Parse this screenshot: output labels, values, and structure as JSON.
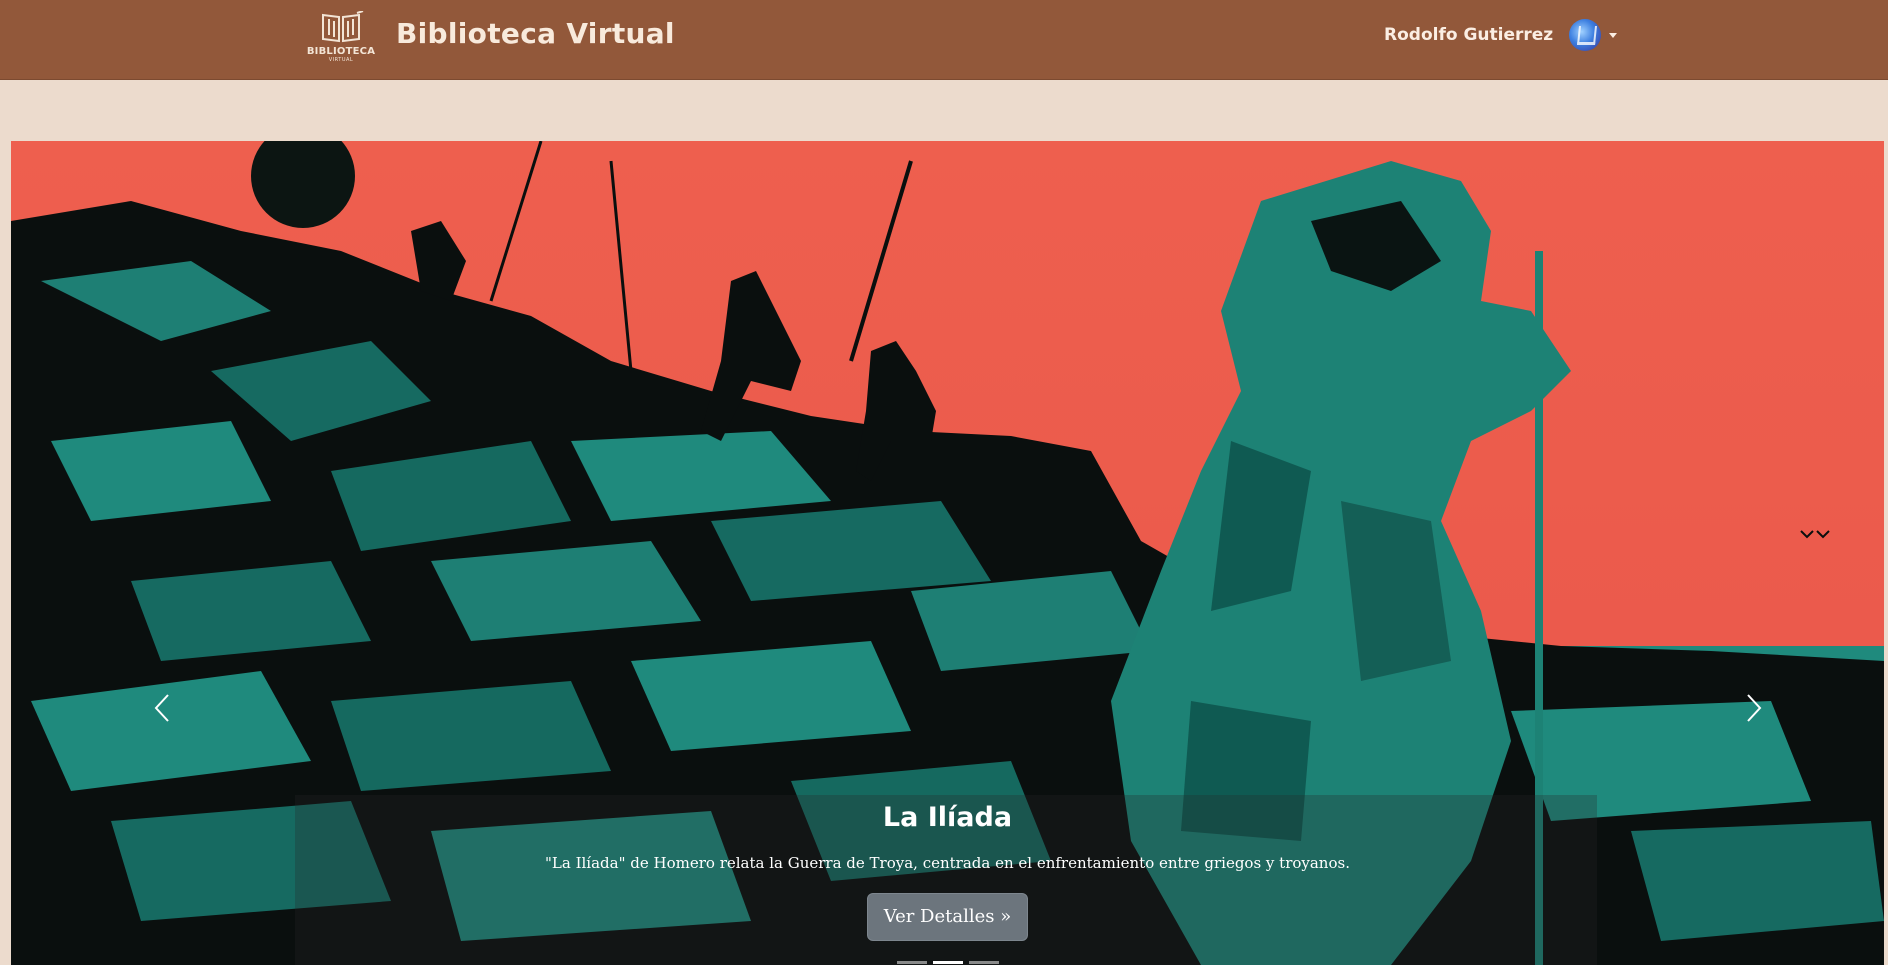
{
  "header": {
    "logo_text": "BIBLIOTECA",
    "logo_subtext": "VIRTUAL",
    "title": "Biblioteca Virtual",
    "user_name": "Rodolfo Gutierrez"
  },
  "carousel": {
    "slide": {
      "title": "La Ilíada",
      "description": "\"La Ilíada\" de Homero relata la Guerra de Troya, centrada en el enfrentamiento entre griegos y troyanos.",
      "button_label": "Ver Detalles »"
    },
    "indicator_count": 3,
    "active_indicator": 2
  },
  "colors": {
    "header_bg": "#92583a",
    "page_bg": "#ecdbcd",
    "slide_sky": "#ec5c4c",
    "slide_teal": "#1f8a7d",
    "button_bg": "#6c757d"
  },
  "icons": [
    "book-logo-icon",
    "avatar",
    "caret-down-icon",
    "chevron-left-icon",
    "chevron-right-icon"
  ]
}
